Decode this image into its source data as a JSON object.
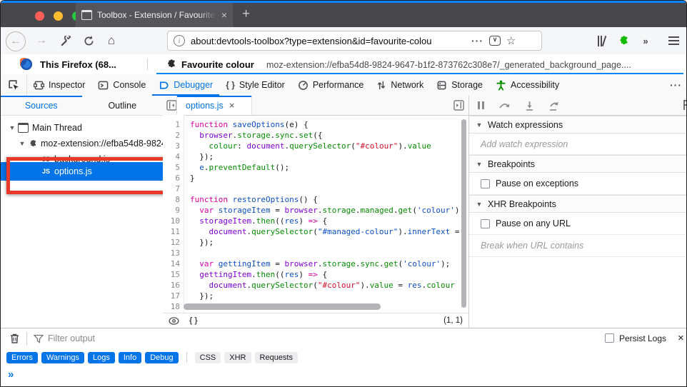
{
  "colors": {
    "accent_blue": "#0074e8",
    "tab_highlight_blue": "#0a84ff",
    "annotation_red": "#e8392a",
    "addon_green": "#12bc00",
    "a11y_green": "#058b00"
  },
  "window": {
    "tab_title": "Toolbox - Extension / Favourite",
    "close_glyph": "×",
    "new_tab_glyph": "+"
  },
  "navbar": {
    "url": "about:devtools-toolbox?type=extension&id=favourite-colou",
    "page_actions_dots": "···",
    "overflow_chevron": "»",
    "pocket_glyph": "∨"
  },
  "extension_bar": {
    "runtime_label": "This Firefox (68...",
    "extension_name": "Favourite colour",
    "extension_url": "moz-extension://efba54d8-9824-9647-b1f2-873762c308e7/_generated_background_page...."
  },
  "devtools_tabs": {
    "inspector": "Inspector",
    "console": "Console",
    "debugger": "Debugger",
    "style_editor_icon": "{ }",
    "style_editor": "Style Editor",
    "performance": "Performance",
    "network": "Network",
    "storage": "Storage",
    "accessibility": "Accessibility",
    "more_dots": "···"
  },
  "sources_panel": {
    "sources_tab": "Sources",
    "outline_tab": "Outline",
    "tree": [
      {
        "label": "Main Thread"
      },
      {
        "label": "moz-extension://efba54d8-9824"
      },
      {
        "badge": "JS",
        "label": "background.js"
      },
      {
        "badge": "JS",
        "label": "options.js"
      }
    ]
  },
  "editor": {
    "tab_label": "options.js",
    "close_glyph": "×",
    "pretty_print_glyph": "{ }",
    "cursor_position": "(1, 1)",
    "token_colors": {
      "k": "#dd00a9",
      "v": "#8000d7",
      "p": "#058b00",
      "d": "#0d4fc8",
      "s": "#d7102b",
      "t": "#1a1a1e"
    },
    "lines": [
      [
        [
          "k",
          "function "
        ],
        [
          "d",
          "saveOptions"
        ],
        [
          "t",
          "(e) {"
        ]
      ],
      [
        [
          "t",
          "  "
        ],
        [
          "v",
          "browser"
        ],
        [
          "t",
          "."
        ],
        [
          "p",
          "storage"
        ],
        [
          "t",
          "."
        ],
        [
          "p",
          "sync"
        ],
        [
          "t",
          "."
        ],
        [
          "p",
          "set"
        ],
        [
          "t",
          "({"
        ]
      ],
      [
        [
          "t",
          "    "
        ],
        [
          "p",
          "colour"
        ],
        [
          "t",
          ": "
        ],
        [
          "v",
          "document"
        ],
        [
          "t",
          "."
        ],
        [
          "p",
          "querySelector"
        ],
        [
          "t",
          "("
        ],
        [
          "s",
          "\"#colour\""
        ],
        [
          "t",
          ")."
        ],
        [
          "p",
          "value"
        ]
      ],
      [
        [
          "t",
          "  });"
        ]
      ],
      [
        [
          "t",
          "  "
        ],
        [
          "d",
          "e"
        ],
        [
          "t",
          "."
        ],
        [
          "p",
          "preventDefault"
        ],
        [
          "t",
          "();"
        ]
      ],
      [
        [
          "t",
          "}"
        ]
      ],
      [],
      [
        [
          "k",
          "function "
        ],
        [
          "d",
          "restoreOptions"
        ],
        [
          "t",
          "() {"
        ]
      ],
      [
        [
          "t",
          "  "
        ],
        [
          "k",
          "var "
        ],
        [
          "d",
          "storageItem"
        ],
        [
          "t",
          " = "
        ],
        [
          "v",
          "browser"
        ],
        [
          "t",
          "."
        ],
        [
          "p",
          "storage"
        ],
        [
          "t",
          "."
        ],
        [
          "p",
          "managed"
        ],
        [
          "t",
          "."
        ],
        [
          "p",
          "get"
        ],
        [
          "t",
          "("
        ],
        [
          "d",
          "'colour'"
        ],
        [
          "t",
          ")"
        ]
      ],
      [
        [
          "t",
          "  "
        ],
        [
          "v",
          "storageItem"
        ],
        [
          "t",
          "."
        ],
        [
          "p",
          "then"
        ],
        [
          "t",
          "(("
        ],
        [
          "d",
          "res"
        ],
        [
          "t",
          ") "
        ],
        [
          "k",
          "=>"
        ],
        [
          "t",
          " {"
        ]
      ],
      [
        [
          "t",
          "    "
        ],
        [
          "v",
          "document"
        ],
        [
          "t",
          "."
        ],
        [
          "p",
          "querySelector"
        ],
        [
          "t",
          "("
        ],
        [
          "d",
          "\"#managed-colour\""
        ],
        [
          "t",
          ")."
        ],
        [
          "d",
          "innerText"
        ],
        [
          "t",
          " ="
        ]
      ],
      [
        [
          "t",
          "  });"
        ]
      ],
      [],
      [
        [
          "t",
          "  "
        ],
        [
          "k",
          "var "
        ],
        [
          "d",
          "gettingItem"
        ],
        [
          "t",
          " = "
        ],
        [
          "v",
          "browser"
        ],
        [
          "t",
          "."
        ],
        [
          "p",
          "storage"
        ],
        [
          "t",
          "."
        ],
        [
          "p",
          "sync"
        ],
        [
          "t",
          "."
        ],
        [
          "p",
          "get"
        ],
        [
          "t",
          "("
        ],
        [
          "d",
          "'colour'"
        ],
        [
          "t",
          ");"
        ]
      ],
      [
        [
          "t",
          "  "
        ],
        [
          "v",
          "gettingItem"
        ],
        [
          "t",
          "."
        ],
        [
          "p",
          "then"
        ],
        [
          "t",
          "(("
        ],
        [
          "d",
          "res"
        ],
        [
          "t",
          ") "
        ],
        [
          "k",
          "=>"
        ],
        [
          "t",
          " {"
        ]
      ],
      [
        [
          "t",
          "    "
        ],
        [
          "v",
          "document"
        ],
        [
          "t",
          "."
        ],
        [
          "p",
          "querySelector"
        ],
        [
          "t",
          "("
        ],
        [
          "s",
          "\"#colour\""
        ],
        [
          "t",
          ")."
        ],
        [
          "p",
          "value"
        ],
        [
          "t",
          " = "
        ],
        [
          "d",
          "res"
        ],
        [
          "t",
          "."
        ],
        [
          "p",
          "colour"
        ]
      ],
      [
        [
          "t",
          "  });"
        ]
      ],
      []
    ]
  },
  "debugger_panel": {
    "watch_header": "Watch expressions",
    "watch_placeholder": "Add watch expression",
    "breakpoints_header": "Breakpoints",
    "pause_exceptions_label": "Pause on exceptions",
    "xhr_header": "XHR Breakpoints",
    "pause_any_url_label": "Pause on any URL",
    "xhr_placeholder": "Break when URL contains",
    "add_glyph": "+"
  },
  "console_bar": {
    "filter_placeholder": "Filter output",
    "persist_label": "Persist Logs",
    "close_glyph": "×",
    "active_filters": [
      "Errors",
      "Warnings",
      "Logs",
      "Info",
      "Debug"
    ],
    "inactive_filters": [
      "CSS",
      "XHR",
      "Requests"
    ],
    "prompt_glyph": "»"
  }
}
